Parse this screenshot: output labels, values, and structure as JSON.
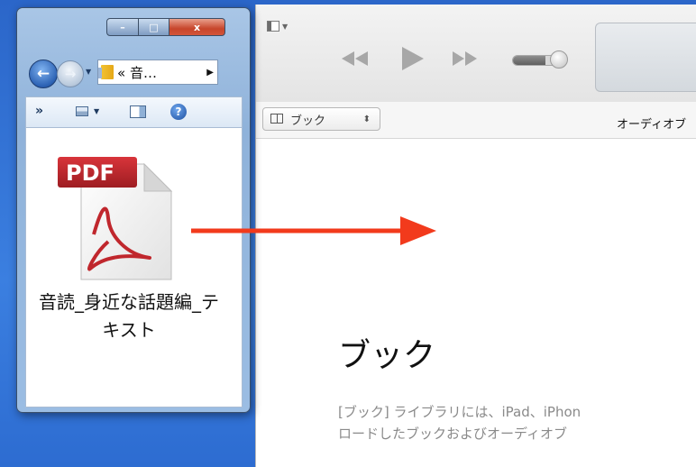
{
  "explorer": {
    "caption_buttons": {
      "minimize": "–",
      "maximize": "□",
      "close": "x"
    },
    "address_text": "« 音…",
    "toolbar": {
      "overflow": "»"
    },
    "file": {
      "badge": "PDF",
      "name": "音読_身近な話題編_テキスト",
      "icon": "pdf-file-icon"
    }
  },
  "itunes": {
    "library_selector": "ブック",
    "audiobook_tab": "オーディオブ",
    "heading": "ブック",
    "description_line1": "[ブック] ライブラリには、iPad、iPhon",
    "description_line2": "ロードしたブックおよびオーディオブ"
  },
  "annotation": {
    "arrow_color": "#f23a1c"
  },
  "colors": {
    "desktop": "#2f6fd0",
    "pdf_red": "#c0272d"
  }
}
